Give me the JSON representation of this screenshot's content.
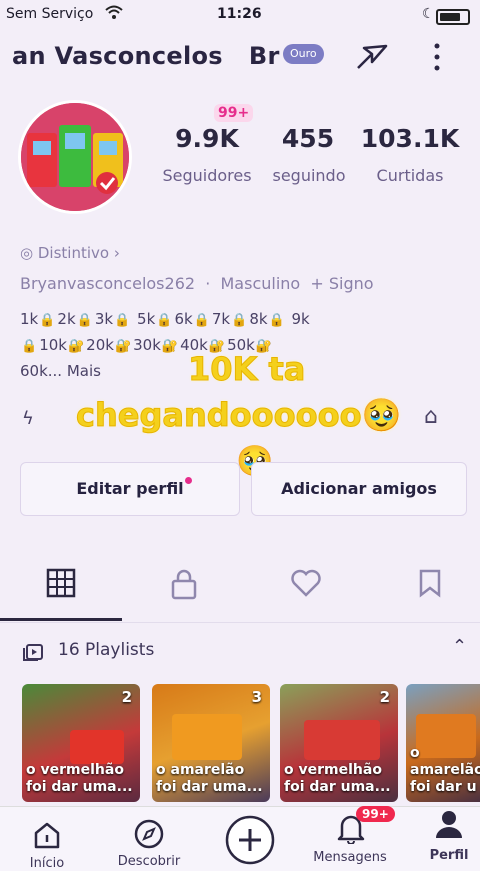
{
  "status_bar": {
    "carrier": "Sem Serviço",
    "time": "11:26"
  },
  "header": {
    "name": "an Vasconcelos",
    "name_suffix": "Br",
    "badge": "Ouro"
  },
  "notification_pill": "99+",
  "stats": [
    {
      "value": "9.9K",
      "label": "Seguidores"
    },
    {
      "value": "455",
      "label": "seguindo"
    },
    {
      "value": "103.1K",
      "label": "Curtidas"
    }
  ],
  "bio": {
    "distintivo": "Distintivo",
    "username": "Bryanvasconcelos262",
    "gender": "Masculino",
    "sign": "+ Signo",
    "milestones_row1": [
      "1k",
      "2k",
      "3k",
      "5k",
      "6k",
      "7k",
      "8k",
      "9k"
    ],
    "milestones_row2": [
      "10k",
      "20k",
      "30k",
      "40k",
      "50k"
    ],
    "milestones_row3": "60k...",
    "more": "Mais"
  },
  "overlay": {
    "line1": "10K ta",
    "line2": "chegandoooooo",
    "emoji": "🥹"
  },
  "buttons": {
    "edit": "Editar perfil",
    "add_friends": "Adicionar amigos"
  },
  "playlists": {
    "label": "16 Playlists",
    "items": [
      {
        "count": "2",
        "caption1": "o vermelhão",
        "caption2": "foi dar uma...",
        "color": "#c43a3a"
      },
      {
        "count": "3",
        "caption1": "o amarelão",
        "caption2": "foi dar uma...",
        "color": "#d77a18"
      },
      {
        "count": "2",
        "caption1": "o vermelhão",
        "caption2": "foi dar uma...",
        "color": "#b8343a"
      },
      {
        "count": "",
        "caption1": "o amarelão",
        "caption2": "foi dar u",
        "color": "#c96a1c"
      }
    ]
  },
  "nav": {
    "home": "Início",
    "discover": "Descobrir",
    "messages": "Mensagens",
    "messages_badge": "99+",
    "profile": "Perfil"
  },
  "colors": {
    "accent_pink": "#e62d8c",
    "overlay_yellow": "#f4d01c",
    "text_dark": "#2b2740"
  }
}
